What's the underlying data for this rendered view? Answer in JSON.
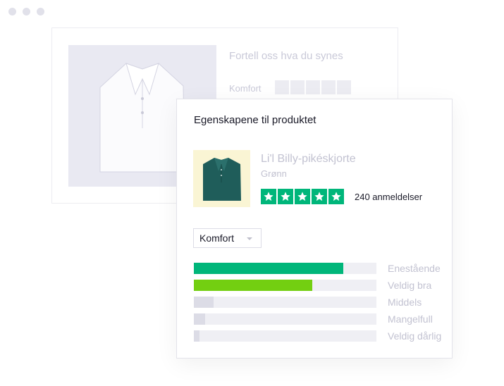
{
  "back_card": {
    "title": "Fortell oss hva du synes",
    "rating_label": "Komfort"
  },
  "front_card": {
    "title": "Egenskapene til produktet",
    "product": {
      "name": "Li'l Billy-pikéskjorte",
      "variant": "Grønn",
      "rating_stars": 5,
      "review_count": "240 anmeldelser"
    },
    "dropdown": {
      "selected": "Komfort"
    },
    "distribution": [
      {
        "label": "Enestående",
        "fraction": 0.82,
        "color": "#00b67a"
      },
      {
        "label": "Veldig bra",
        "fraction": 0.65,
        "color": "#73cf11"
      },
      {
        "label": "Middels",
        "fraction": 0.11,
        "color": "#dcdce6"
      },
      {
        "label": "Mangelfull",
        "fraction": 0.06,
        "color": "#dcdce6"
      },
      {
        "label": "Veldig dårlig",
        "fraction": 0.03,
        "color": "#dcdce6"
      }
    ]
  },
  "colors": {
    "accent_green": "#00b67a",
    "light_green": "#73cf11",
    "thumb_background": "#faf5d4"
  }
}
